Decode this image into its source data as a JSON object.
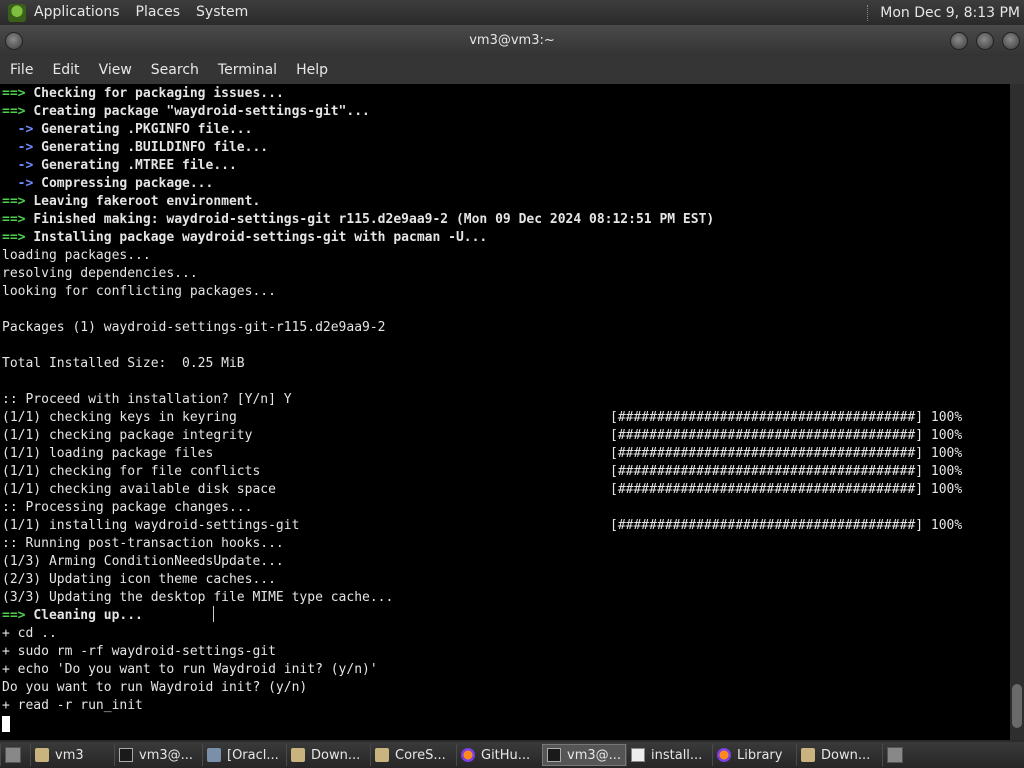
{
  "panel": {
    "menus": [
      "Applications",
      "Places",
      "System"
    ],
    "clock": "Mon Dec 9,  8:13 PM"
  },
  "window": {
    "title": "vm3@vm3:~"
  },
  "menubar": [
    "File",
    "Edit",
    "View",
    "Search",
    "Terminal",
    "Help"
  ],
  "terminal": {
    "lines": [
      {
        "t": [
          {
            "s": "==> ",
            "c": "green"
          },
          {
            "s": "Checking for packaging issues...",
            "c": "bold"
          }
        ]
      },
      {
        "t": [
          {
            "s": "==> ",
            "c": "green"
          },
          {
            "s": "Creating package \"waydroid-settings-git\"...",
            "c": "bold"
          }
        ]
      },
      {
        "t": [
          {
            "s": "  -> ",
            "c": "blue"
          },
          {
            "s": "Generating .PKGINFO file...",
            "c": "bold"
          }
        ]
      },
      {
        "t": [
          {
            "s": "  -> ",
            "c": "blue"
          },
          {
            "s": "Generating .BUILDINFO file...",
            "c": "bold"
          }
        ]
      },
      {
        "t": [
          {
            "s": "  -> ",
            "c": "blue"
          },
          {
            "s": "Generating .MTREE file...",
            "c": "bold"
          }
        ]
      },
      {
        "t": [
          {
            "s": "  -> ",
            "c": "blue"
          },
          {
            "s": "Compressing package...",
            "c": "bold"
          }
        ]
      },
      {
        "t": [
          {
            "s": "==> ",
            "c": "green"
          },
          {
            "s": "Leaving fakeroot environment.",
            "c": "bold"
          }
        ]
      },
      {
        "t": [
          {
            "s": "==> ",
            "c": "green"
          },
          {
            "s": "Finished making: waydroid-settings-git r115.d2e9aa9-2 (Mon 09 Dec 2024 08:12:51 PM EST)",
            "c": "bold"
          }
        ]
      },
      {
        "t": [
          {
            "s": "==> ",
            "c": "green"
          },
          {
            "s": "Installing package waydroid-settings-git with pacman -U...",
            "c": "bold"
          }
        ]
      },
      {
        "t": [
          {
            "s": "loading packages..."
          }
        ]
      },
      {
        "t": [
          {
            "s": "resolving dependencies..."
          }
        ]
      },
      {
        "t": [
          {
            "s": "looking for conflicting packages..."
          }
        ]
      },
      {
        "t": [
          {
            "s": ""
          }
        ]
      },
      {
        "t": [
          {
            "s": "Packages (1) waydroid-settings-git-r115.d2e9aa9-2"
          }
        ]
      },
      {
        "t": [
          {
            "s": ""
          }
        ]
      },
      {
        "t": [
          {
            "s": "Total Installed Size:  0.25 MiB"
          }
        ]
      },
      {
        "t": [
          {
            "s": ""
          }
        ]
      },
      {
        "t": [
          {
            "s": ":: Proceed with installation? [Y/n] Y"
          }
        ]
      },
      {
        "t": [
          {
            "s": "(1/1) checking keys in keyring"
          }
        ],
        "p": "[######################################] 100%"
      },
      {
        "t": [
          {
            "s": "(1/1) checking package integrity"
          }
        ],
        "p": "[######################################] 100%"
      },
      {
        "t": [
          {
            "s": "(1/1) loading package files"
          }
        ],
        "p": "[######################################] 100%"
      },
      {
        "t": [
          {
            "s": "(1/1) checking for file conflicts"
          }
        ],
        "p": "[######################################] 100%"
      },
      {
        "t": [
          {
            "s": "(1/1) checking available disk space"
          }
        ],
        "p": "[######################################] 100%"
      },
      {
        "t": [
          {
            "s": ":: Processing package changes..."
          }
        ]
      },
      {
        "t": [
          {
            "s": "(1/1) installing waydroid-settings-git"
          }
        ],
        "p": "[######################################] 100%"
      },
      {
        "t": [
          {
            "s": ":: Running post-transaction hooks..."
          }
        ]
      },
      {
        "t": [
          {
            "s": "(1/3) Arming ConditionNeedsUpdate..."
          }
        ]
      },
      {
        "t": [
          {
            "s": "(2/3) Updating icon theme caches..."
          }
        ]
      },
      {
        "t": [
          {
            "s": "(3/3) Updating the desktop file MIME type cache..."
          }
        ]
      },
      {
        "t": [
          {
            "s": "==> ",
            "c": "green"
          },
          {
            "s": "Cleaning up...",
            "c": "bold"
          }
        ]
      },
      {
        "t": [
          {
            "s": "+ cd .."
          }
        ]
      },
      {
        "t": [
          {
            "s": "+ sudo rm -rf waydroid-settings-git"
          }
        ]
      },
      {
        "t": [
          {
            "s": "+ echo 'Do you want to run Waydroid init? (y/n)'"
          }
        ]
      },
      {
        "t": [
          {
            "s": "Do you want to run Waydroid init? (y/n)"
          }
        ]
      },
      {
        "t": [
          {
            "s": "+ read -r run_init"
          }
        ]
      }
    ]
  },
  "taskbar": [
    {
      "label": "",
      "icon": "show-desktop-icon",
      "name": "show-desktop-button",
      "w": 30
    },
    {
      "label": "vm3",
      "icon": "home-folder-icon",
      "name": "taskbar-vm3-folder",
      "w": 84
    },
    {
      "label": "vm3@...",
      "icon": "terminal-icon",
      "name": "taskbar-terminal-1",
      "w": 88
    },
    {
      "label": "[Oracl...",
      "icon": "virtualbox-icon",
      "name": "taskbar-oracle",
      "w": 84
    },
    {
      "label": "Down...",
      "icon": "folder-icon",
      "name": "taskbar-downloads-1",
      "w": 84
    },
    {
      "label": "CoreS...",
      "icon": "folder-icon",
      "name": "taskbar-cores",
      "w": 86
    },
    {
      "label": "GitHu...",
      "icon": "firefox-icon",
      "name": "taskbar-github",
      "w": 86
    },
    {
      "label": "vm3@...",
      "icon": "terminal-icon",
      "name": "taskbar-terminal-active",
      "w": 84,
      "active": true
    },
    {
      "label": "install...",
      "icon": "text-editor-icon",
      "name": "taskbar-install",
      "w": 86
    },
    {
      "label": "Library",
      "icon": "firefox-icon",
      "name": "taskbar-library",
      "w": 84
    },
    {
      "label": "Down...",
      "icon": "folder-icon",
      "name": "taskbar-downloads-2",
      "w": 86
    },
    {
      "label": "",
      "icon": "workspace-icon",
      "name": "workspace-switcher",
      "w": 40
    }
  ]
}
